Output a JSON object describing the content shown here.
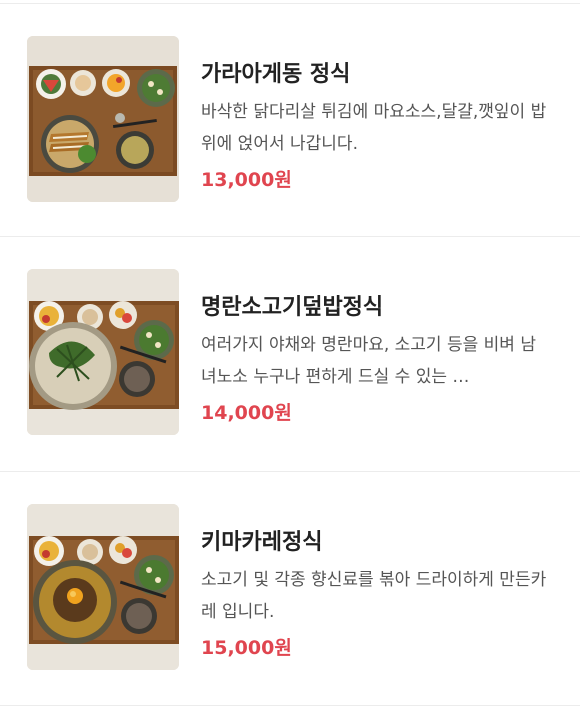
{
  "menu": {
    "items": [
      {
        "name": "가라아게동 정식",
        "description": "바삭한 닭다리살 튀김에 마요소스,달걀,깻잎이 밥 위에 얹어서 나갑니다.",
        "price": "13,000원",
        "image": "karaage-don-set-photo"
      },
      {
        "name": "명란소고기덮밥정식",
        "description": "여러가지 야채와 명란마요, 소고기 등을 비벼 남녀노소 누구나 편하게 드실 수 있는 …",
        "price": "14,000원",
        "image": "myeongran-beef-rice-bowl-set-photo"
      },
      {
        "name": "키마카레정식",
        "description": "소고기 및 각종 향신료를 볶아 드라이하게 만든카레 입니다.",
        "price": "15,000원",
        "image": "keema-curry-set-photo"
      }
    ]
  }
}
